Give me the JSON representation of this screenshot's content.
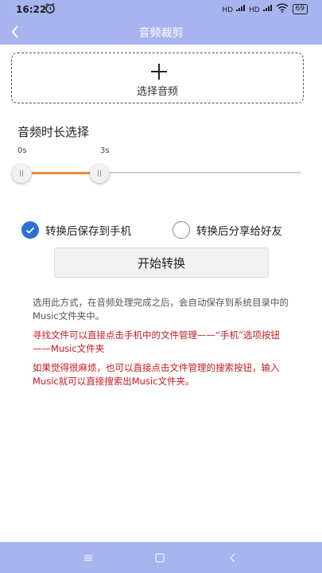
{
  "status_bar": {
    "time": "16:22",
    "alarm_icon": "alarm-clock-icon",
    "signal_1": "HD",
    "signal_2": "HD",
    "wifi_icon": "wifi-icon",
    "battery": "69"
  },
  "app_bar": {
    "back_icon": "chevron-left-icon",
    "title": "音频裁剪"
  },
  "select_audio": {
    "icon": "plus-icon",
    "label": "选择音频"
  },
  "duration": {
    "title": "音频时长选择",
    "start_label": "0s",
    "end_label": "3s",
    "fill_fraction": 0.25
  },
  "options": {
    "save_to_phone": {
      "label": "转换后保存到手机",
      "checked": true
    },
    "share_to_friend": {
      "label": "转换后分享给好友",
      "checked": false
    }
  },
  "convert_button": "开始转换",
  "notes": {
    "info": "选用此方式，在音频处理完成之后，会自动保存到系统目录中的Music文件夹中。",
    "hint1": "寻找文件可以直接点击手机中的文件管理——“手机”选项按钮——Music文件夹",
    "hint2": "如果觉得很麻烦，也可以直接点击文件管理的搜索按钮，输入Music就可以直接搜索出Music文件夹。"
  },
  "nav_bar": {
    "menu_icon": "menu-icon",
    "home_icon": "home-square-icon",
    "back_icon": "back-triangle-icon"
  },
  "colors": {
    "bar": "#a7b4ee",
    "accent_blue": "#2b6fd6",
    "slider_fill": "#e98a2b",
    "hint_red": "#c4181f"
  }
}
